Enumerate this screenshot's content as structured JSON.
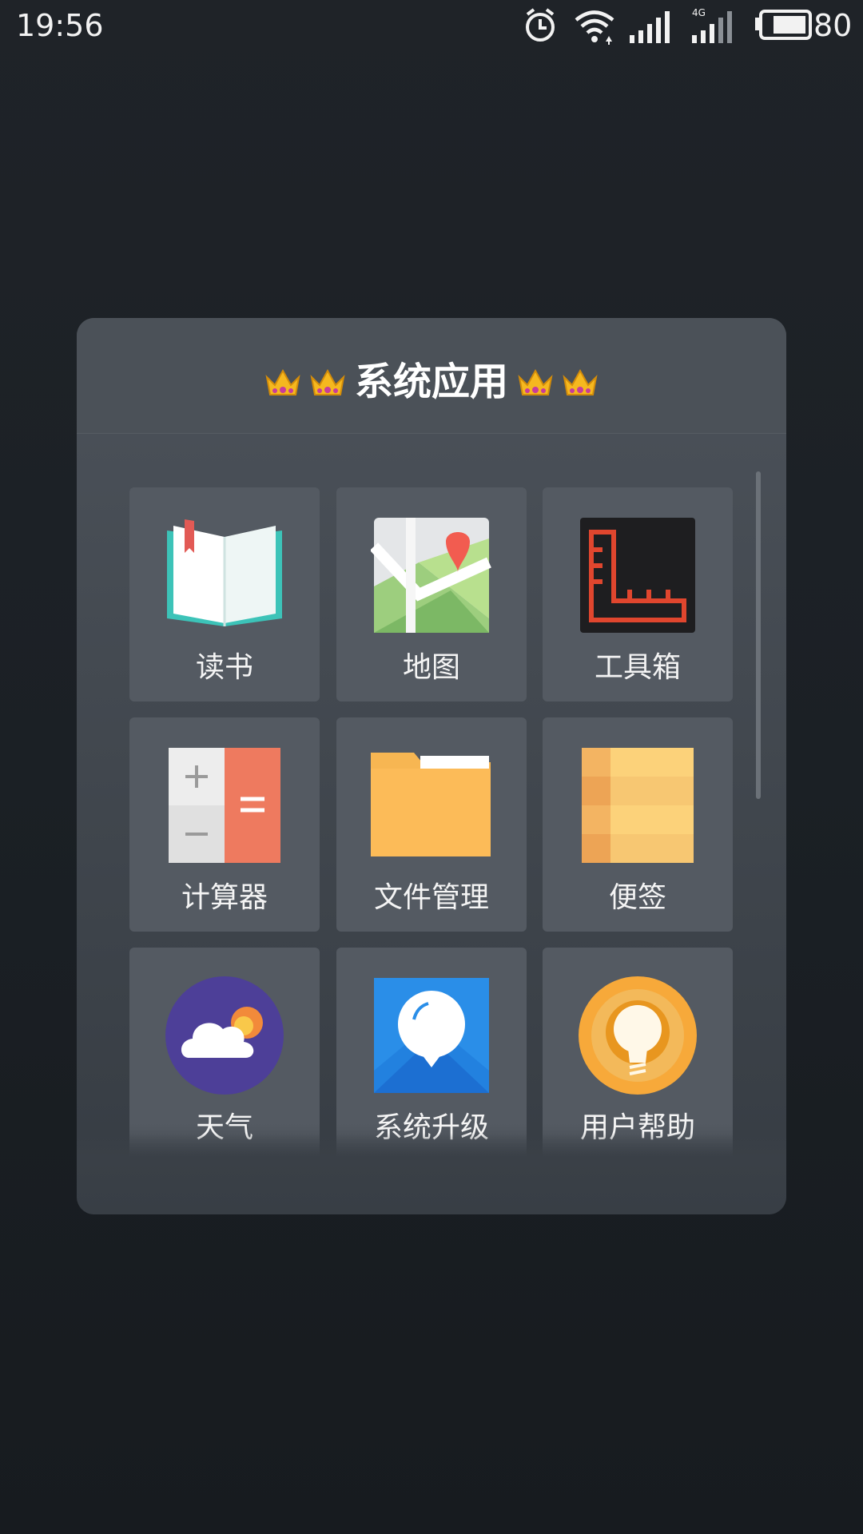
{
  "status_bar": {
    "time": "19:56",
    "battery_level": "80",
    "network_type": "4G",
    "icons": [
      "alarm-icon",
      "wifi-icon",
      "signal-icon",
      "4g-signal-icon",
      "battery-icon"
    ]
  },
  "folder": {
    "title": "系统应用",
    "title_decoration": "👑"
  },
  "apps": [
    {
      "label": "读书",
      "icon": "book-icon"
    },
    {
      "label": "地图",
      "icon": "map-icon"
    },
    {
      "label": "工具箱",
      "icon": "toolbox-icon"
    },
    {
      "label": "计算器",
      "icon": "calculator-icon"
    },
    {
      "label": "文件管理",
      "icon": "folder-icon"
    },
    {
      "label": "便签",
      "icon": "notes-icon"
    },
    {
      "label": "天气",
      "icon": "weather-icon"
    },
    {
      "label": "系统升级",
      "icon": "system-update-icon"
    },
    {
      "label": "用户帮助",
      "icon": "help-bulb-icon"
    }
  ],
  "colors": {
    "background": "#1b2025",
    "folder_bg": "#454b52",
    "tile_bg": "#545a62"
  }
}
